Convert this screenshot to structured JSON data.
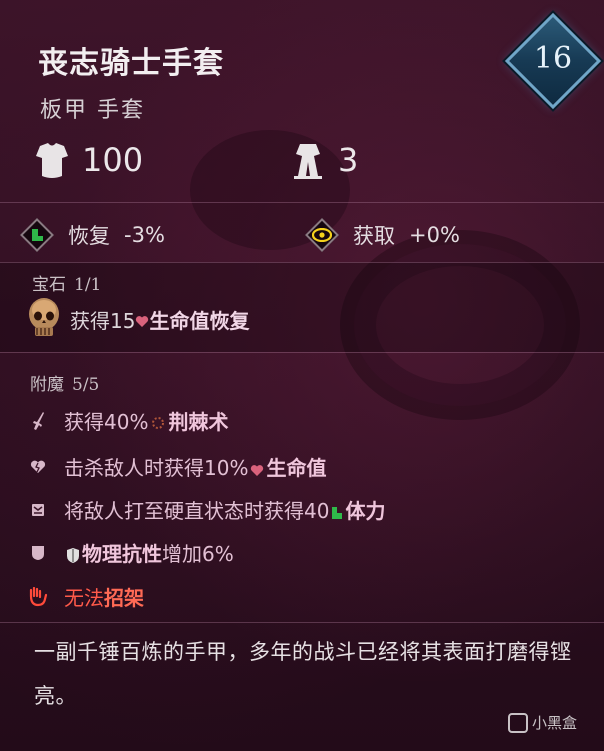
{
  "item": {
    "name": "丧志骑士手套",
    "type": "板甲 手套",
    "level": "16"
  },
  "stats": {
    "armor": "100",
    "weight": "3"
  },
  "attributes": {
    "recover_label": "恢复",
    "recover_value": "-3%",
    "gain_label": "获取",
    "gain_value": "+0%"
  },
  "gems": {
    "label": "宝石",
    "count": "1/1",
    "effect_prefix": "获得15",
    "effect_name": "生命值恢复"
  },
  "enchantments": {
    "label": "附魔",
    "count": "5/5",
    "items": [
      {
        "prefix": "获得40%",
        "name": "荆棘术",
        "suffix": ""
      },
      {
        "prefix": "击杀敌人时获得10%",
        "name": "生命值",
        "suffix": ""
      },
      {
        "prefix": "将敌人打至硬直状态时获得40",
        "name": "体力",
        "suffix": ""
      },
      {
        "prefix": "",
        "name": "物理抗性",
        "suffix": "增加6%"
      },
      {
        "prefix": "无法",
        "name": "招架",
        "suffix": ""
      }
    ]
  },
  "flavor": "一副千锤百炼的手甲，多年的战斗已经将其表面打磨得铿亮。",
  "watermark": "小黑盒",
  "colors": {
    "enchant_text": "#e2c0d4",
    "negative_text": "#ff5a4a",
    "level_badge": "#173a54",
    "stamina_green": "#2fb84a",
    "gain_yellow": "#f5d21c"
  }
}
